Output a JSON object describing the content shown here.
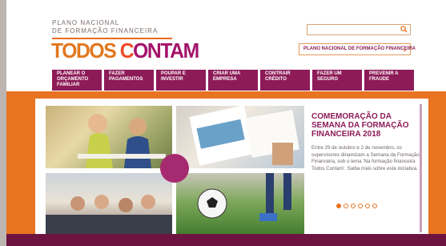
{
  "header": {
    "brand_line1": "PLANO NACIONAL",
    "brand_line2": "DE FORMAÇÃO FINANCEIRA",
    "logo_word1": "TODOS",
    "logo_word2a": "C",
    "logo_word2b": "ONTAM",
    "search": {
      "value": "",
      "icon": "search-icon"
    },
    "site_selector": {
      "selected": "PLANO NACIONAL DE FORMAÇÃO FINANCEIRA",
      "icon": "chevron-down-icon"
    }
  },
  "nav": {
    "items": [
      {
        "label": "PLANEAR O ORÇAMENTO FAMILIAR"
      },
      {
        "label": "FAZER PAGAMENTOS"
      },
      {
        "label": "POUPAR E INVESTIR"
      },
      {
        "label": "CRIAR UMA EMPRESA"
      },
      {
        "label": "CONTRAIR CRÉDITO"
      },
      {
        "label": "FAZER UM SEGURO"
      },
      {
        "label": "PREVENIR A FRAUDE"
      }
    ]
  },
  "slider": {
    "headline": "COMEMORAÇÃO DA SEMANA DA FORMAÇÃO FINANCEIRA 2018",
    "description": "Entre 29 de outubro e 2 de novembro, os supervisores dinamizam a Semana da Formação Financeira, sob o lema 'Na formação financeira Todos Contam'. Saiba mais sobre esta iniciativa.",
    "slide_count": 6,
    "active_slide": 1
  },
  "colors": {
    "brand_magenta": "#8d1b57",
    "brand_orange": "#e87320"
  }
}
